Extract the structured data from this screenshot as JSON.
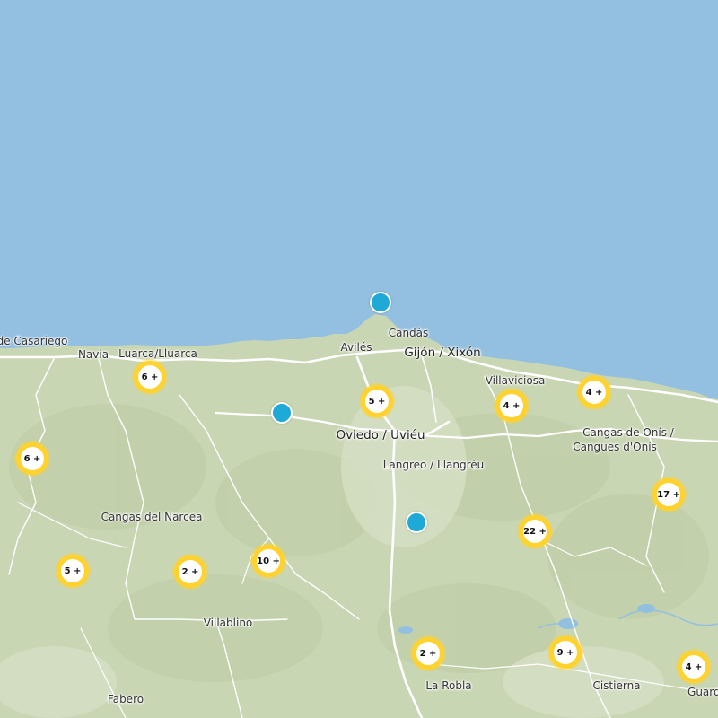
{
  "map": {
    "colors": {
      "sea": "#93bfe0",
      "land": "#c9d6b4",
      "road": "#ffffff",
      "cluster_ring": "#ffd22e",
      "marker": "#1ea9d6"
    },
    "places": [
      {
        "id": "casariego",
        "label": "de Casariego"
      },
      {
        "id": "navia",
        "label": "Navia"
      },
      {
        "id": "luarca",
        "label": "Luarca/Lluarca"
      },
      {
        "id": "aviles",
        "label": "Avilés"
      },
      {
        "id": "candas",
        "label": "Candás"
      },
      {
        "id": "gijon",
        "label": "Gijón / Xixón"
      },
      {
        "id": "villaviciosa",
        "label": "Villaviciosa"
      },
      {
        "id": "oviedo",
        "label": "Oviedo / Uviéu"
      },
      {
        "id": "cangas-onis",
        "label": "Cangas de Onís /"
      },
      {
        "id": "cangues-onis",
        "label": "Cangues d'Onís"
      },
      {
        "id": "langreo",
        "label": "Langreo / Llangréu"
      },
      {
        "id": "cangas-narcea",
        "label": "Cangas del Narcea"
      },
      {
        "id": "villablino",
        "label": "Villablino"
      },
      {
        "id": "fabero",
        "label": "Fabero"
      },
      {
        "id": "la-robla",
        "label": "La Robla"
      },
      {
        "id": "cistierna",
        "label": "Cistierna"
      },
      {
        "id": "guardo",
        "label": "Guardo"
      }
    ],
    "clusters": [
      {
        "label": "6 +"
      },
      {
        "label": "5 +"
      },
      {
        "label": "4 +"
      },
      {
        "label": "4 +"
      },
      {
        "label": "6 +"
      },
      {
        "label": "17 +"
      },
      {
        "label": "22 +"
      },
      {
        "label": "5 +"
      },
      {
        "label": "2 +"
      },
      {
        "label": "10 +"
      },
      {
        "label": "2 +"
      },
      {
        "label": "9 +"
      },
      {
        "label": "4 +"
      }
    ],
    "markers": [
      {
        "name": "point-cabo-penas"
      },
      {
        "name": "point-west-oviedo"
      },
      {
        "name": "point-south-mieres"
      }
    ]
  }
}
